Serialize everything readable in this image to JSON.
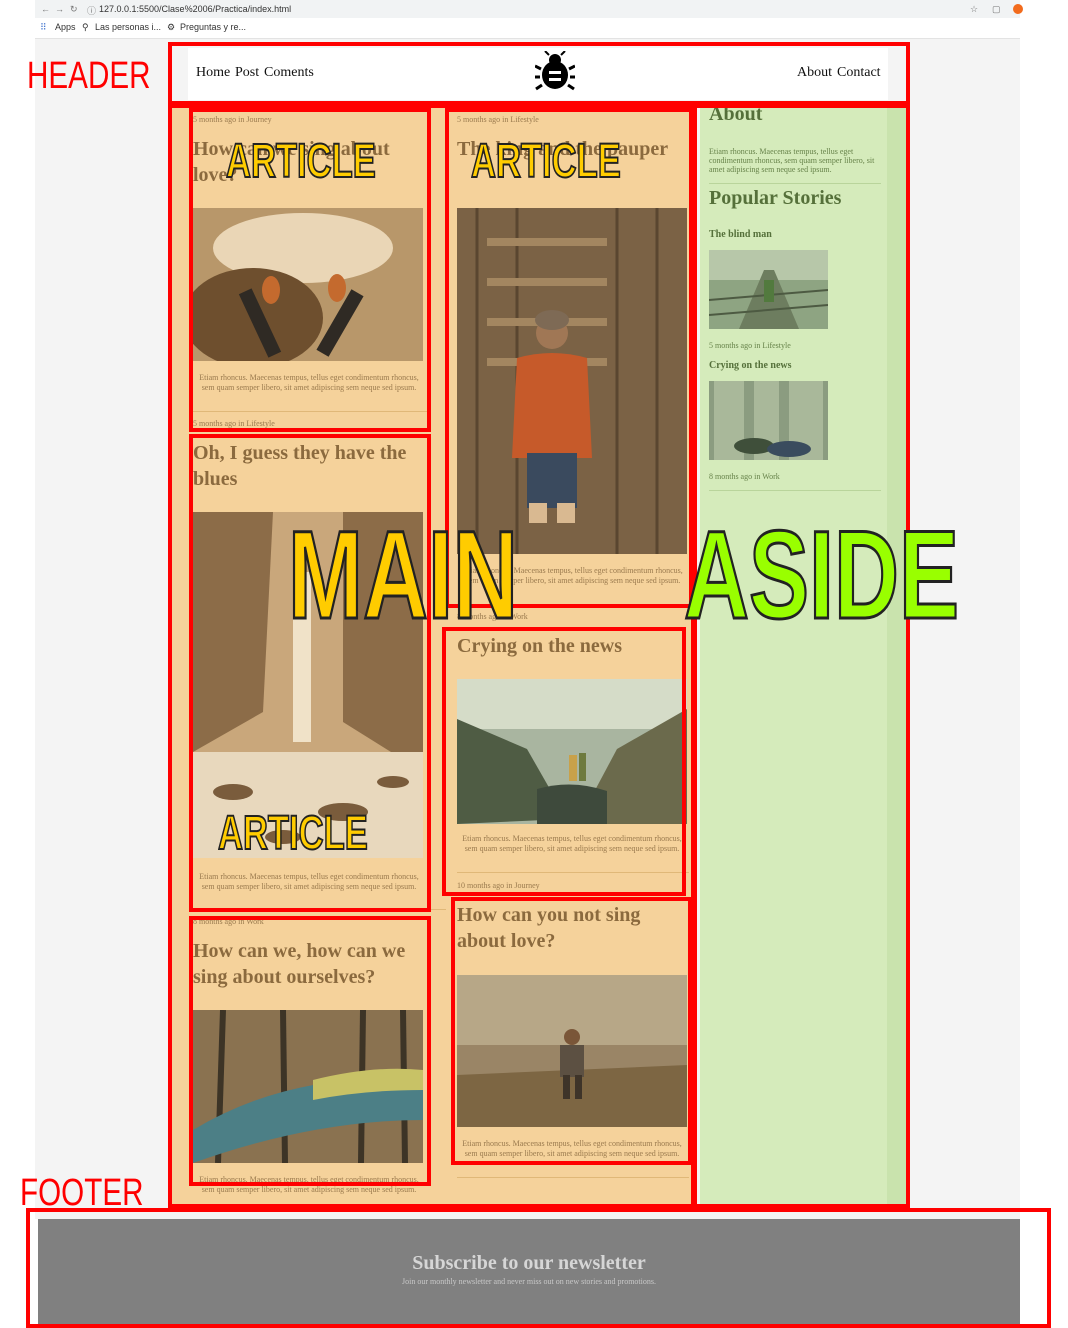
{
  "browser": {
    "url": "127.0.0.1:5500/Clase%2006/Practica/index.html",
    "bookmarks": [
      "Apps",
      "Las personas i...",
      "Preguntas y re..."
    ]
  },
  "header": {
    "nav_left": [
      "Home",
      "Post",
      "Coments"
    ],
    "nav_right": [
      "About",
      "Contact"
    ],
    "logo_icon": "bug-icon"
  },
  "articles": [
    {
      "meta": "5 months ago in Journey",
      "title": "How can we sing about love?",
      "excerpt": "Etiam rhoncus. Maecenas tempus, tellus eget condimentum rhoncus, sem quam semper libero, sit amet adipiscing sem neque sed ipsum."
    },
    {
      "meta": "5 months ago in Lifestyle",
      "title": "The king and the pauper",
      "excerpt": "Etiam rhoncus. Maecenas tempus, tellus eget condimentum rhoncus, sem quam semper libero, sit amet adipiscing sem neque sed ipsum."
    },
    {
      "meta": "5 months ago in Lifestyle",
      "title": "Oh, I guess they have the blues",
      "excerpt": "Etiam rhoncus. Maecenas tempus, tellus eget condimentum rhoncus, sem quam semper libero, sit amet adipiscing sem neque sed ipsum."
    },
    {
      "meta": "8 months ago in Work",
      "title": "Crying on the news",
      "excerpt": "Etiam rhoncus. Maecenas tempus, tellus eget condimentum rhoncus, sem quam semper libero, sit amet adipiscing sem neque sed ipsum."
    },
    {
      "meta": "8 months ago in Work",
      "title": "How can we, how can we sing about ourselves?",
      "excerpt": "Etiam rhoncus. Maecenas tempus, tellus eget condimentum rhoncus, sem quam semper libero, sit amet adipiscing sem neque sed ipsum."
    },
    {
      "meta": "10 months ago in Journey",
      "title": "How can you not sing about love?",
      "excerpt": "Etiam rhoncus. Maecenas tempus, tellus eget condimentum rhoncus, sem quam semper libero, sit amet adipiscing sem neque sed ipsum."
    }
  ],
  "aside": {
    "about_title": "About",
    "about_text": "Etiam rhoncus. Maecenas tempus, tellus eget condimentum rhoncus, sem quam semper libero, sit amet adipiscing sem neque sed ipsum.",
    "popular_title": "Popular Stories",
    "stories": [
      {
        "title": "The blind man",
        "meta": "5 months ago in Lifestyle"
      },
      {
        "title": "Crying on the news",
        "meta": "8 months ago in Work"
      }
    ]
  },
  "footer": {
    "title": "Subscribe to our newsletter",
    "subtitle": "Join our monthly newsletter and never miss out on new stories and promotions."
  },
  "annotations": {
    "header": "HEADER",
    "main": "MAIN",
    "aside": "ASIDE",
    "article": "ARTICLE",
    "footer": "FOOTER"
  },
  "colors": {
    "main_overlay": "#f5d29b",
    "aside_overlay": "#d5ebbb",
    "annotation_red": "#ff0000",
    "label_yellow": "#ffcc00",
    "label_green": "#99ff00",
    "footer_bg": "#808080"
  }
}
